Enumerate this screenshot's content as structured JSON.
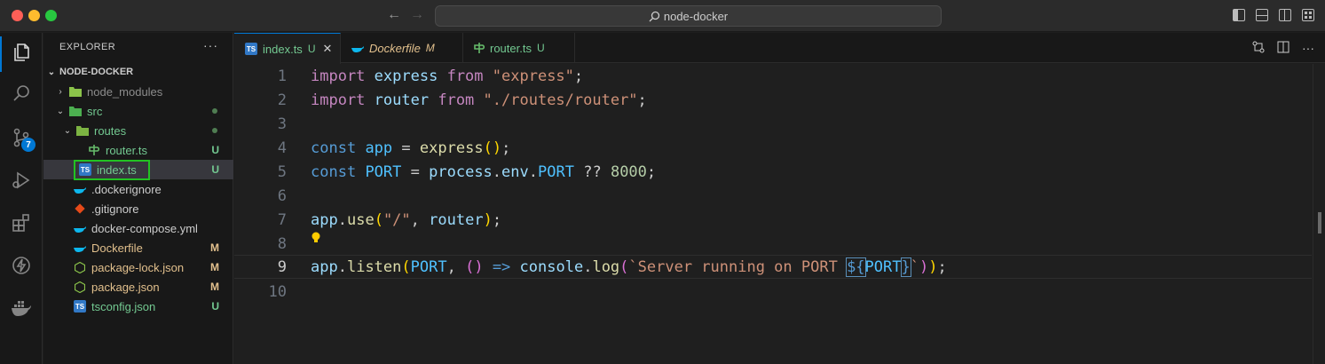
{
  "window": {
    "search_text": "node-docker"
  },
  "activity_bar": {
    "items": [
      {
        "name": "explorer-icon",
        "active": true
      },
      {
        "name": "search-icon"
      },
      {
        "name": "source-control-icon",
        "badge": "7"
      },
      {
        "name": "run-debug-icon"
      },
      {
        "name": "extensions-icon"
      },
      {
        "name": "thunder-client-icon"
      },
      {
        "name": "docker-icon"
      }
    ]
  },
  "sidebar": {
    "title": "EXPLORER",
    "more": "···",
    "root": "NODE-DOCKER",
    "items": [
      {
        "label": "node_modules",
        "kind": "folder",
        "expanded": false,
        "level": 1
      },
      {
        "label": "src",
        "kind": "folder",
        "expanded": true,
        "level": 1,
        "dot": true
      },
      {
        "label": "routes",
        "kind": "folder",
        "expanded": true,
        "level": 2,
        "dot": true
      },
      {
        "label": "router.ts",
        "kind": "file",
        "status": "U",
        "level": 3
      },
      {
        "label": "index.ts",
        "kind": "file",
        "status": "U",
        "level": 2,
        "selected": true
      },
      {
        "label": ".dockerignore",
        "kind": "file",
        "level": 1
      },
      {
        "label": ".gitignore",
        "kind": "file",
        "level": 1
      },
      {
        "label": "docker-compose.yml",
        "kind": "file",
        "level": 1
      },
      {
        "label": "Dockerfile",
        "kind": "file",
        "status": "M",
        "level": 1
      },
      {
        "label": "package-lock.json",
        "kind": "file",
        "status": "M",
        "level": 1
      },
      {
        "label": "package.json",
        "kind": "file",
        "status": "M",
        "level": 1
      },
      {
        "label": "tsconfig.json",
        "kind": "file",
        "status": "U",
        "level": 1
      }
    ]
  },
  "tabs": [
    {
      "label": "index.ts",
      "status": "U",
      "active": true,
      "close": "✕"
    },
    {
      "label": "Dockerfile",
      "status": "M",
      "active": false
    },
    {
      "label": "router.ts",
      "status": "U",
      "active": false
    }
  ],
  "editor": {
    "line_numbers": [
      "1",
      "2",
      "3",
      "4",
      "5",
      "6",
      "7",
      "8",
      "9",
      "10"
    ],
    "current_line": "9",
    "lines": {
      "l1": [
        "import",
        "express",
        "from",
        "\"express\"",
        ";"
      ],
      "l2": [
        "import",
        "router",
        "from",
        "\"./routes/router\"",
        ";"
      ],
      "l4": [
        "const",
        "app",
        "=",
        "express",
        "(",
        ")",
        ";"
      ],
      "l5": [
        "const",
        "PORT",
        "=",
        "process",
        ".",
        "env",
        ".",
        "PORT",
        "??",
        "8000",
        ";"
      ],
      "l7": [
        "app",
        ".",
        "use",
        "(",
        "\"/\"",
        ", ",
        "router",
        ")",
        ";"
      ],
      "l9": [
        "app",
        ".",
        "listen",
        "(",
        "PORT",
        ", ",
        "()",
        "=>",
        "console",
        ".",
        "log",
        "(",
        "`Server running on PORT ",
        "${",
        "PORT",
        "}",
        "`",
        ")",
        ")",
        ";"
      ]
    }
  }
}
